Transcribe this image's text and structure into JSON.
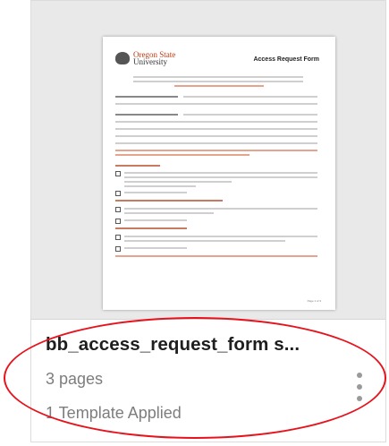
{
  "file": {
    "name": "bb_access_request_form s...",
    "pages": "3 pages",
    "templates": "1 Template Applied"
  },
  "preview": {
    "university_line1": "Oregon State",
    "university_line2": "University",
    "form_title": "Access Request Form",
    "page_label": "Page 1 of 3"
  },
  "colors": {
    "accent_red": "#e8121c",
    "osu_orange": "#c03a12"
  },
  "icons": {
    "more": "more-vertical-icon"
  }
}
